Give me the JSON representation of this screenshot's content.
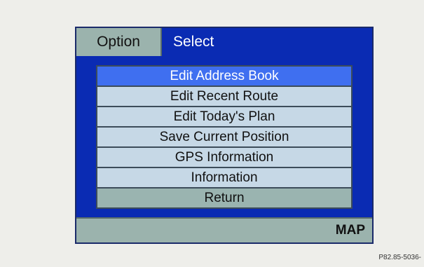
{
  "header": {
    "option_tab": "Option",
    "select_tab": "Select"
  },
  "menu": {
    "items": [
      {
        "label": "Edit Address Book",
        "state": "selected"
      },
      {
        "label": "Edit Recent Route"
      },
      {
        "label": "Edit Today's Plan"
      },
      {
        "label": "Save Current Position"
      },
      {
        "label": "GPS Information"
      },
      {
        "label": "Information"
      },
      {
        "label": "Return"
      }
    ]
  },
  "footer": {
    "map_label": "MAP"
  },
  "figure_caption": "P82.85-5036-",
  "colors": {
    "screen_background": "#0a2bb3",
    "selected_item": "#3f6ff0",
    "menu_item": "#c6d8e6",
    "bar": "#9bb3ad"
  }
}
